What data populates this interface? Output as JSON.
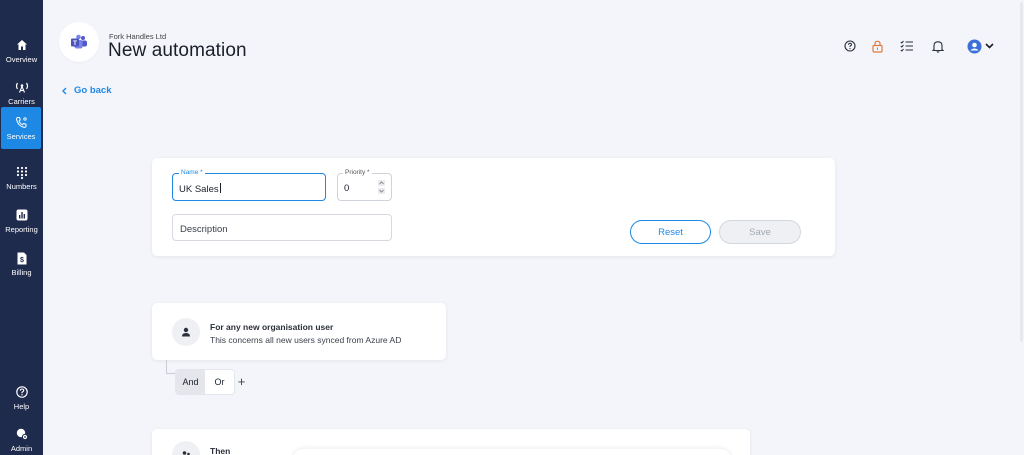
{
  "sidebar": {
    "items": [
      {
        "label": "Overview",
        "icon": "home-icon"
      },
      {
        "label": "Carriers",
        "icon": "antenna-icon"
      },
      {
        "label": "Services",
        "icon": "phone-settings-icon",
        "active": true
      },
      {
        "label": "Numbers",
        "icon": "dialpad-icon"
      },
      {
        "label": "Reporting",
        "icon": "bar-chart-icon"
      },
      {
        "label": "Billing",
        "icon": "invoice-icon"
      }
    ],
    "bottom_items": [
      {
        "label": "Help",
        "icon": "help-icon"
      },
      {
        "label": "Admin",
        "icon": "admin-icon"
      }
    ]
  },
  "header": {
    "org_name": "Fork Handles Ltd",
    "title": "New automation",
    "logo_icon": "teams-logo-icon",
    "icons": [
      "help-circle-icon",
      "lock-icon",
      "checklist-icon",
      "bell-icon",
      "user-avatar-icon",
      "chevron-down-icon"
    ]
  },
  "nav": {
    "go_back": "Go back"
  },
  "form": {
    "name_label": "Name *",
    "name_value": "UK Sales",
    "priority_label": "Priority *",
    "priority_value": "0",
    "description_placeholder": "Description",
    "reset_label": "Reset",
    "save_label": "Save"
  },
  "condition": {
    "title": "For any new organisation user",
    "subtitle": "This concerns all new users synced from Azure AD",
    "and_label": "And",
    "or_label": "Or",
    "add_label": "+"
  },
  "action": {
    "then_label": "Then"
  },
  "colors": {
    "sidebar_bg": "#1f2b4d",
    "accent": "#1e88e5",
    "page_bg": "#f4f5fa",
    "lock_icon": "#e07a3f"
  }
}
